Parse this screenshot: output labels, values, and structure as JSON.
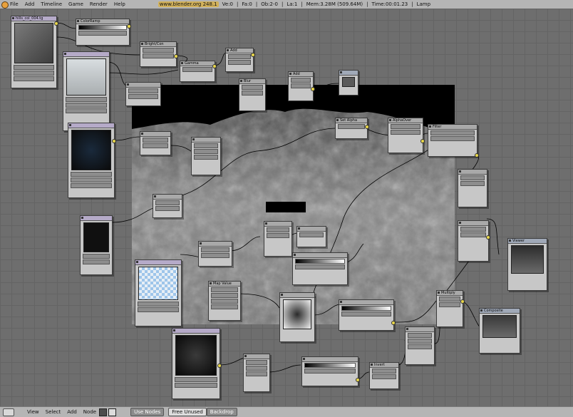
{
  "app": {
    "url": "www.blender.org 248.1"
  },
  "top_menu": [
    "File",
    "Add",
    "Timeline",
    "Game",
    "Render",
    "Help"
  ],
  "stats": [
    "Ve:0",
    "Fa:0",
    "Ob:2-0",
    "La:1",
    "Mem:3.28M (509.64M)",
    "Time:00:01.23",
    "Lamp"
  ],
  "bottom_menu": [
    "View",
    "Select",
    "Add",
    "Node"
  ],
  "bottom_buttons": {
    "use_nodes": "Use Nodes",
    "free_unused": "Free Unused",
    "backdrop": "Backdrop"
  },
  "colors": {
    "image_node": "#b5aac8",
    "wire": "#000000",
    "socket": "#e8d64a",
    "grid": "#646464"
  },
  "nodes": {
    "top_tex": "hills_col_004.tg",
    "colorramp": "ColorRamp",
    "brightcon": "Bright/Con",
    "gamma": "Gamma",
    "add": "Add",
    "blur": "Blur",
    "mix_add": "Add",
    "viewer": "Viewer",
    "setalpha": "Set Alpha",
    "alphaover": "AlphaOver",
    "filter": "Filter",
    "composite": "Composite",
    "mapvalue": "Map Value",
    "invert": "Invert",
    "multiply": "Multiply"
  }
}
